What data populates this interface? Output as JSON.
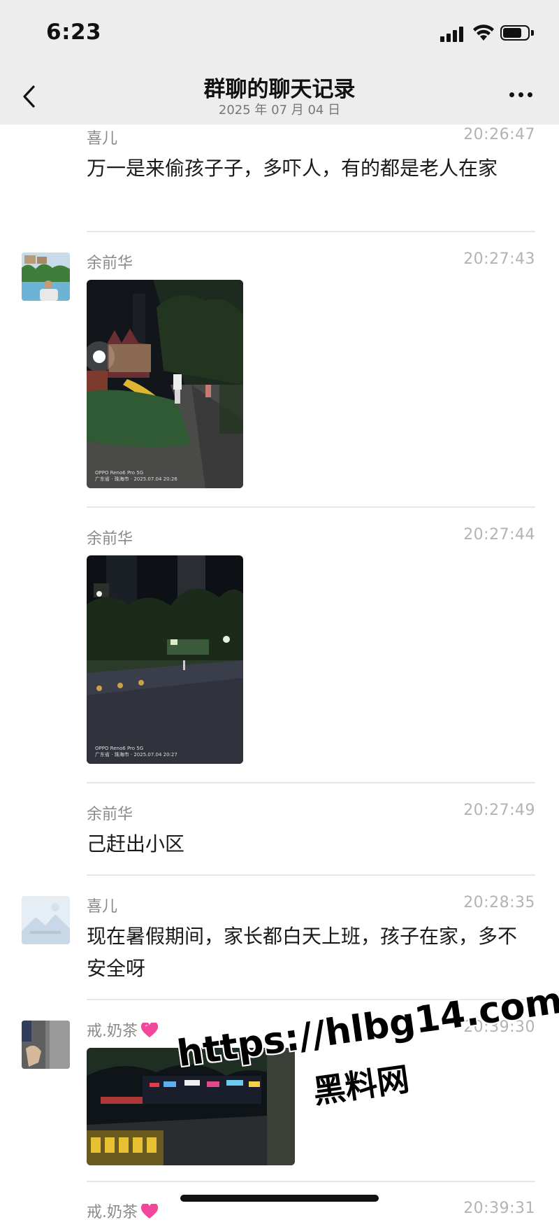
{
  "status_bar": {
    "time": "6:23"
  },
  "nav": {
    "title": "群聊的聊天记录",
    "date": "2025 年 07 月 04 日"
  },
  "messages": [
    {
      "sender": "喜儿",
      "time": "20:26:47",
      "text": "万一是来偷孩子子，多吓人，有的都是老人在家"
    },
    {
      "sender": "余前华",
      "time": "20:27:43",
      "photo_caption": "OPPO Reno6 Pro 5G\n广东省 · 珠海市 · 2025.07.04 20:26"
    },
    {
      "sender": "余前华",
      "time": "20:27:44",
      "photo_caption": "OPPO Reno6 Pro 5G\n广东省 · 珠海市 · 2025.07.04 20:27"
    },
    {
      "sender": "余前华",
      "time": "20:27:49",
      "text": "己赶出小区"
    },
    {
      "sender": "喜儿",
      "time": "20:28:35",
      "text": "现在暑假期间，家长都白天上班，孩子在家，多不安全呀"
    },
    {
      "sender": "戒.奶茶",
      "time": "20:39:30"
    },
    {
      "sender": "戒.奶茶",
      "time": "20:39:31"
    }
  ],
  "watermark": {
    "url": "https://hlbg14.com",
    "label": "黑料网"
  },
  "icons": {
    "back": "chevron-left-icon",
    "more": "more-dots-icon",
    "heart": "pink-heart-icon"
  },
  "colors": {
    "header_bg": "#ededed",
    "sender": "#8a8a8a",
    "timestamp": "#b3b3b3",
    "heart": "#f2479a"
  }
}
